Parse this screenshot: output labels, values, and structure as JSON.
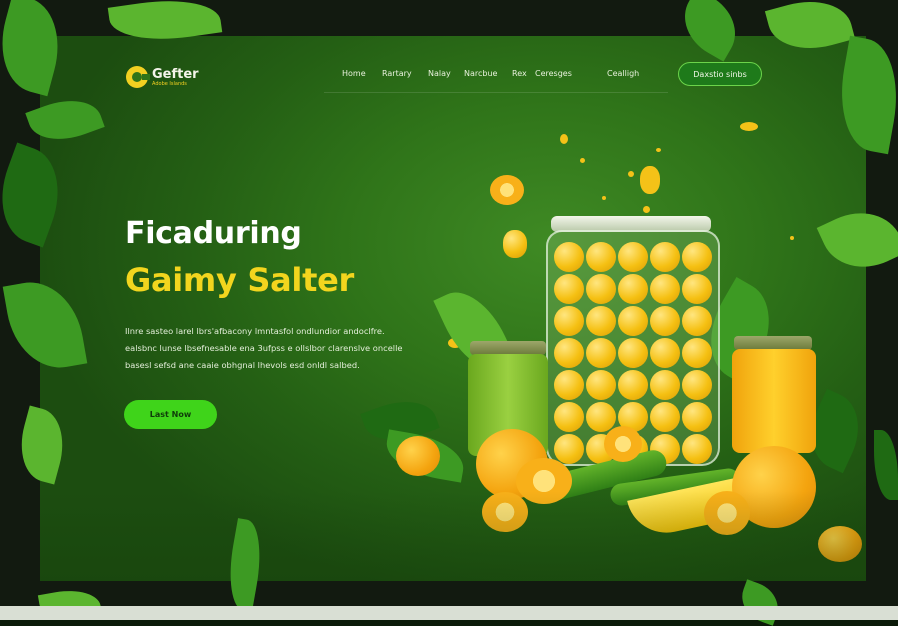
{
  "brand": {
    "name": "Gefter",
    "tagline": "Adobe Islands"
  },
  "nav": {
    "items": [
      "Home",
      "Rartary",
      "Nalay",
      "Narcbue",
      "Rex",
      "Ceresges"
    ],
    "login": "Cealligh",
    "cta": "Daxstio sinbs"
  },
  "hero": {
    "title": "Ficaduring",
    "highlight": "Gaimy Salter",
    "body_lines": [
      "Ilnre sasteo larel lbrs'afbacony lmntasfol ondlundior andoclfre.",
      "ealsbnc lunse lbsefnesable ena 3ufpss e ollslbor clarenslve oncelle",
      "basesl sefsd ane caaie obhgnal lhevols esd onldl salbed."
    ],
    "cta": "Last Now"
  },
  "colors": {
    "accent_green": "#3fd41a",
    "brand_yellow": "#f2d51e",
    "panel_green": "#2f7419"
  }
}
